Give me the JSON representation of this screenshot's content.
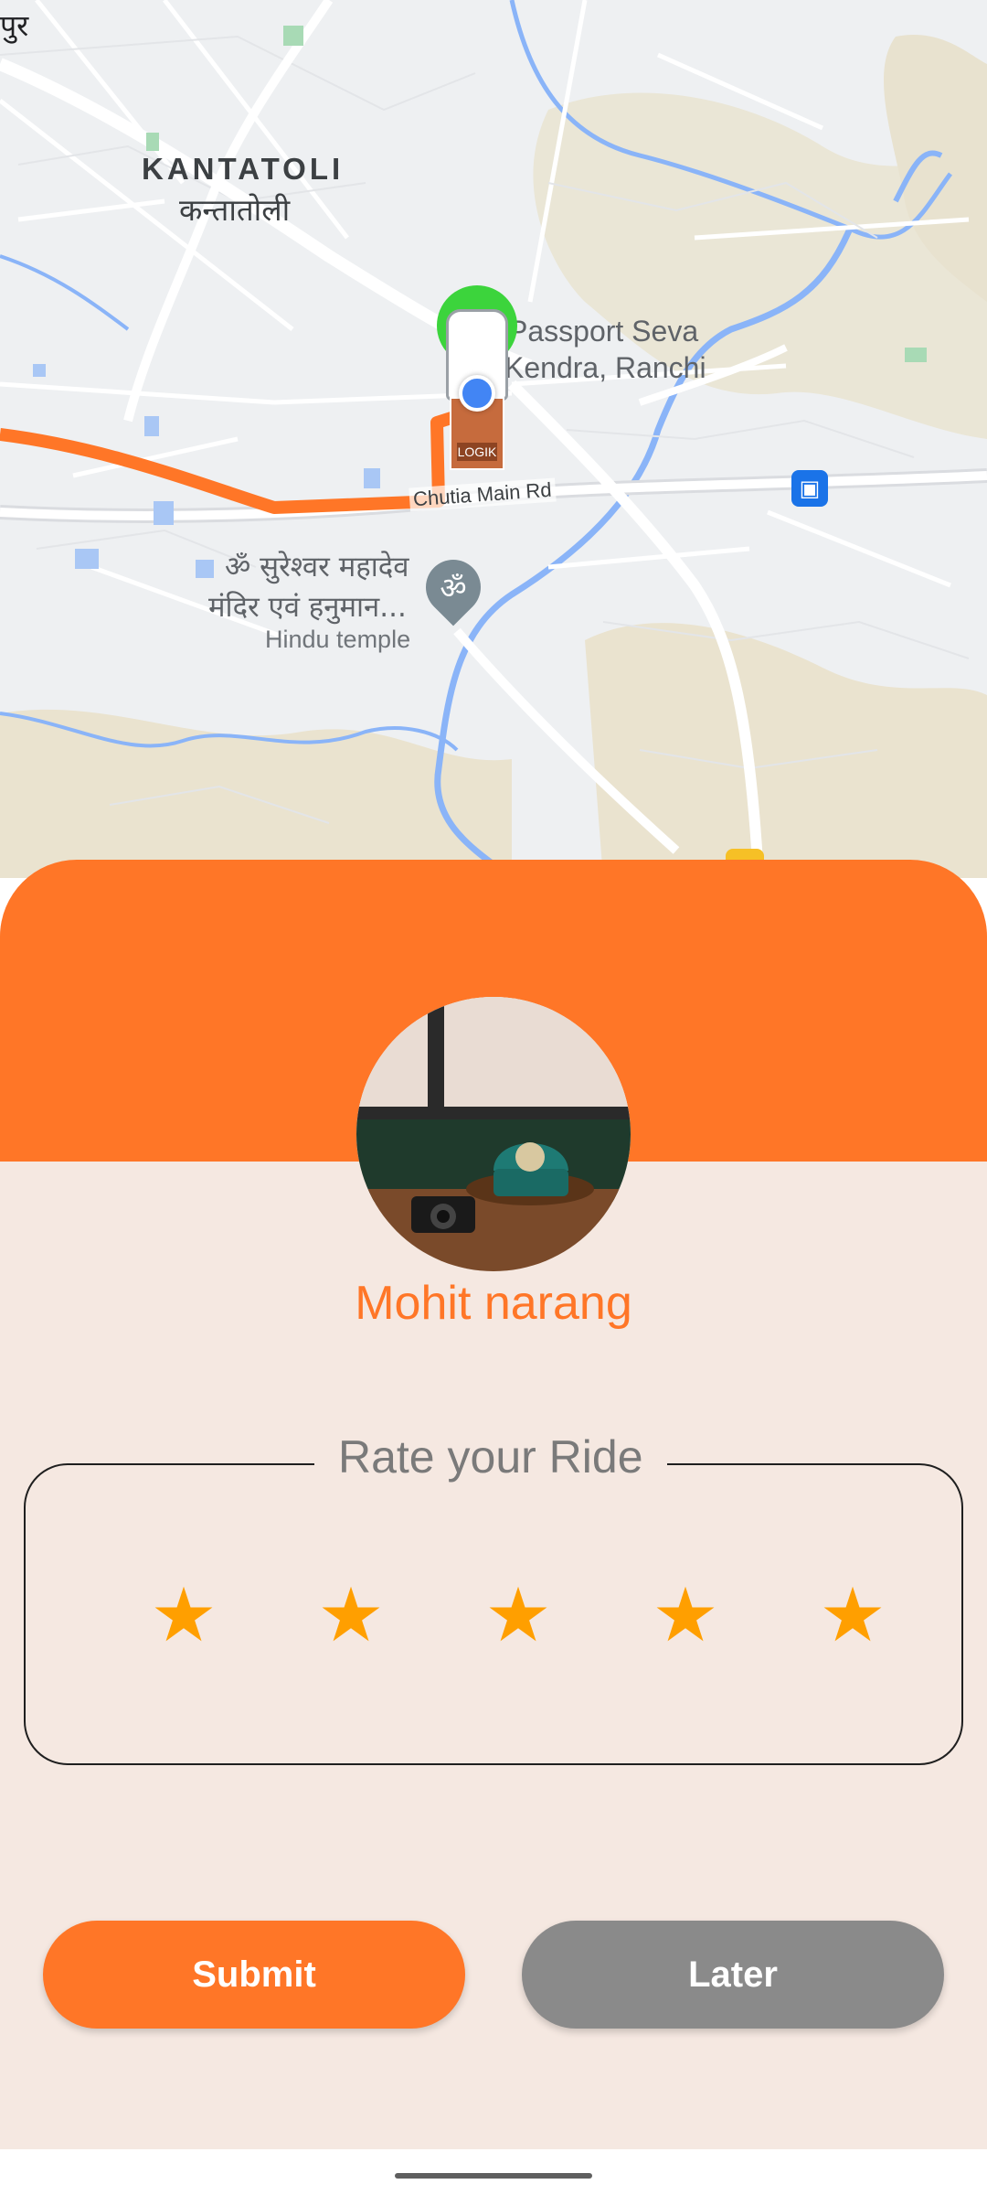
{
  "map": {
    "corner_label": "पुर",
    "area_label": "KANTATOLI",
    "area_label_hindi": "कन्तातोली",
    "poi_name_line1": "Passport Seva",
    "poi_name_line2": "Kendra, Ranchi",
    "road_name": "Chutia Main Rd",
    "temple_name_line1": "ॐ सुरेश्वर महादेव",
    "temple_name_line2": "मंदिर एवं हनुमान...",
    "temple_type": "Hindu temple",
    "temple_icon_glyph": "ॐ",
    "vehicle_label": "LOGIK",
    "route_color": "#ff7627"
  },
  "sheet": {
    "accent_color": "#ff7627",
    "background_color": "#f5e8e1",
    "driver_name": "Mohit narang",
    "rating_title": "Rate your Ride",
    "stars": [
      "★",
      "★",
      "★",
      "★",
      "★"
    ],
    "star_color": "#ff9f00",
    "submit_label": "Submit",
    "later_label": "Later"
  }
}
